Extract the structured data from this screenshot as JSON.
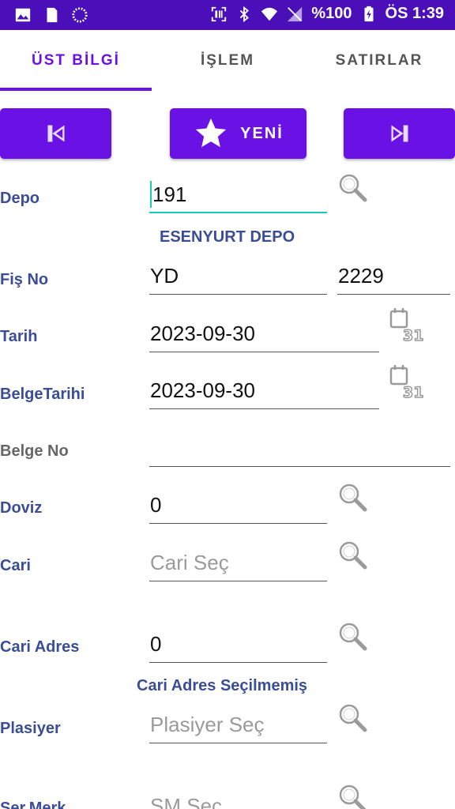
{
  "status_bar": {
    "battery_text": "%100",
    "time": "ÖS 1:39",
    "icons": [
      "image-icon",
      "sd-card-icon",
      "loading-icon",
      "scan-icon",
      "bluetooth-icon",
      "wifi-icon",
      "no-signal-icon",
      "battery-charging-icon"
    ]
  },
  "tabs": [
    {
      "label": "ÜST BİLGİ",
      "active": true
    },
    {
      "label": "İŞLEM",
      "active": false
    },
    {
      "label": "SATIRLAR",
      "active": false
    }
  ],
  "nav": {
    "prev_icon": "skip-previous-icon",
    "new_label": "YENİ",
    "new_icon": "star-icon",
    "next_icon": "skip-next-icon"
  },
  "colors": {
    "accent": "#6a12e6",
    "status_bar": "#4a0fb8",
    "label": "#3a4d96",
    "focus": "#1dc9b7"
  },
  "form": {
    "depo": {
      "label": "Depo",
      "value": "191",
      "info": "ESENYURT DEPO"
    },
    "fis_no": {
      "label": "Fiş No",
      "prefix": "YD",
      "number": "2229"
    },
    "tarih": {
      "label": "Tarih",
      "value": "2023-09-30"
    },
    "belge_tarihi": {
      "label": "BelgeTarihi",
      "value": "2023-09-30"
    },
    "belge_no": {
      "label": "Belge No",
      "value": ""
    },
    "doviz": {
      "label": "Doviz",
      "value": "0"
    },
    "cari": {
      "label": "Cari",
      "placeholder": "Cari Seç"
    },
    "cari_adres": {
      "label": "Cari Adres",
      "value": "0",
      "info": "Cari Adres Seçilmemiş"
    },
    "plasiyer": {
      "label": "Plasiyer",
      "placeholder": "Plasiyer Seç"
    },
    "ser_merk": {
      "label": "Ser.Merk",
      "placeholder": "SM Seç"
    }
  }
}
